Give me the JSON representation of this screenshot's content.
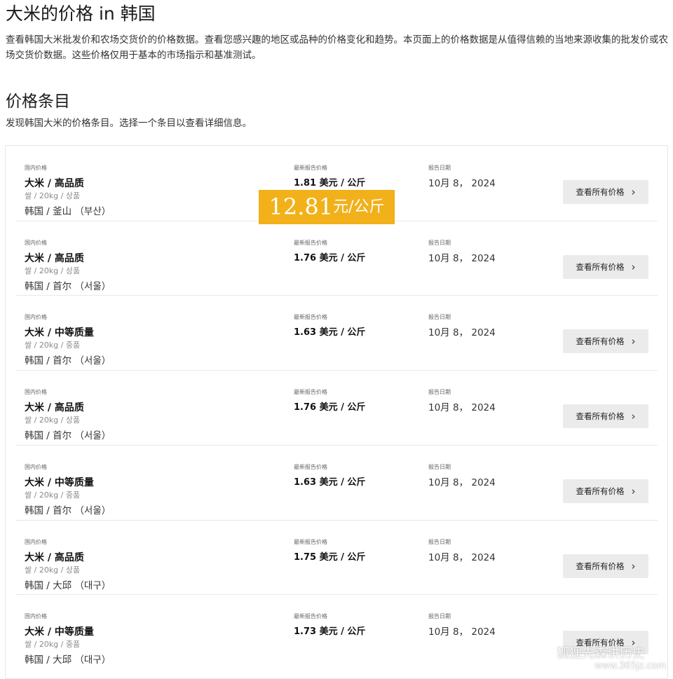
{
  "page": {
    "title": "大米的价格 in 韩国",
    "intro": "查看韩国大米批发价和农场交货价的价格数据。查看您感兴趣的地区或品种的价格变化和趋势。本页面上的价格数据是从值得信赖的当地来源收集的批发价或农场交货价数据。这些价格仅用于基本的市场指示和基准测试。"
  },
  "section": {
    "title": "价格条目",
    "description": "发现韩国大米的价格条目。选择一个条目以查看详细信息。"
  },
  "columns": {
    "domestic": "国内价格",
    "latest": "最新报告价格",
    "date": "报告日期"
  },
  "button_label": "查看所有价格",
  "rows": [
    {
      "name": "大米 / 高品质",
      "sub": "쌀 / 20kg / 상품",
      "location": "韩国 / 釜山 （부산）",
      "price": "1.81 美元 / 公斤",
      "date": "10月 8， 2024"
    },
    {
      "name": "大米 / 高品质",
      "sub": "쌀 / 20kg / 상품",
      "location": "韩国 / 首尔 （서울）",
      "price": "1.76 美元 / 公斤",
      "date": "10月 8， 2024"
    },
    {
      "name": "大米 / 中等质量",
      "sub": "쌀 / 20kg / 중품",
      "location": "韩国 / 首尔 （서울）",
      "price": "1.63 美元 / 公斤",
      "date": "10月 8， 2024"
    },
    {
      "name": "大米 / 高品质",
      "sub": "쌀 / 20kg / 상품",
      "location": "韩国 / 首尔 （서울）",
      "price": "1.76 美元 / 公斤",
      "date": "10月 8， 2024"
    },
    {
      "name": "大米 / 中等质量",
      "sub": "쌀 / 20kg / 중품",
      "location": "韩国 / 首尔 （서울）",
      "price": "1.63 美元 / 公斤",
      "date": "10月 8， 2024"
    },
    {
      "name": "大米 / 高品质",
      "sub": "쌀 / 20kg / 상품",
      "location": "韩国 / 大邱 （대구）",
      "price": "1.75 美元 / 公斤",
      "date": "10月 8， 2024"
    },
    {
      "name": "大米 / 中等质量",
      "sub": "쌀 / 20kg / 중품",
      "location": "韩国 / 大邱 （대구）",
      "price": "1.73 美元 / 公斤",
      "date": "10月 8， 2024"
    }
  ],
  "highlight": {
    "value": "12.81",
    "unit": "元/公斤",
    "color": "#f2b11a"
  },
  "watermark": {
    "text": "狐狸先森讲历史",
    "url": "www.365jz.com"
  },
  "icons": {
    "chevron": "chevron-right-icon"
  }
}
